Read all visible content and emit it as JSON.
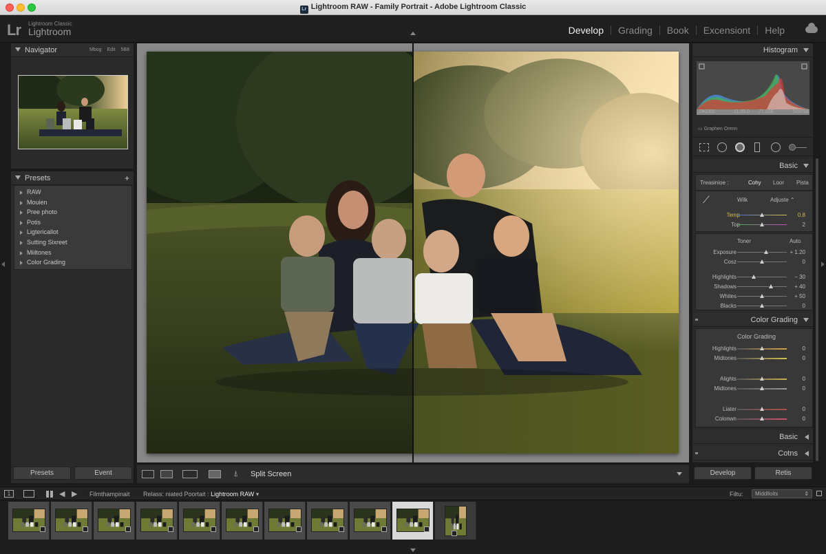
{
  "window": {
    "title": "Lightroom RAW - Family Portrait - Adobe Lightroom Classic",
    "app_icon": "Lr"
  },
  "logo": {
    "mark": "Lr",
    "small": "Lightroom Classic",
    "big": "Lightroom"
  },
  "modules": [
    {
      "label": "Develop",
      "active": true
    },
    {
      "label": "Grading",
      "active": false
    },
    {
      "label": "Book",
      "active": false
    },
    {
      "label": "Excensiont",
      "active": false
    },
    {
      "label": "Help",
      "active": false
    }
  ],
  "navigator": {
    "title": "Navigator",
    "options": [
      "Mbog",
      "Edit",
      "5B8"
    ]
  },
  "presets": {
    "title": "Presets",
    "items": [
      "RAW",
      "Mouien",
      "Pree photo",
      "Potis",
      "Ligtericallot",
      "Sutting Sixreet",
      "Miiltones",
      "Color Grading"
    ]
  },
  "left_buttons": {
    "presets": "Presets",
    "event": "Event"
  },
  "toolbar": {
    "view_mode": "Split Screen"
  },
  "histogram": {
    "title": "Histogram",
    "info": [
      "DKD00",
      "11.35.0",
      "77.10E",
      "Normal"
    ],
    "caption": "Graphen Orenn"
  },
  "basic": {
    "title": "Basic",
    "treatment_label": "Treasinioe :",
    "treatment_opts": [
      "Cohy",
      "Loor",
      "Pista"
    ],
    "wb_label": "Wilk",
    "wb_value": "Adjuste",
    "temp": {
      "label": "Temp",
      "value": "0.8",
      "pos": 0.5
    },
    "tint": {
      "label": "Top",
      "value": "2",
      "pos": 0.5
    },
    "tone_label": "Toner",
    "auto_label": "Auto",
    "sliders": [
      {
        "label": "Exposure",
        "value": "+ 1.20",
        "pos": 0.58
      },
      {
        "label": "Cosz",
        "value": "0",
        "pos": 0.5
      },
      {
        "label": "Highlights",
        "value": "− 30",
        "pos": 0.33
      },
      {
        "label": "Shadows",
        "value": "+ 40",
        "pos": 0.68
      },
      {
        "label": "Whites",
        "value": "+ 50",
        "pos": 0.5
      },
      {
        "label": "Blacks",
        "value": "0",
        "pos": 0.5
      }
    ]
  },
  "color_grading": {
    "title": "Color Grading",
    "subtitle": "Color Grading",
    "sliders": [
      {
        "label": "Highlights",
        "value": "0",
        "pos": 0.5
      },
      {
        "label": "Midtones",
        "value": "0",
        "pos": 0.5
      },
      {
        "label": "Alights",
        "value": "0",
        "pos": 0.5
      },
      {
        "label": "Midtones",
        "value": "0",
        "pos": 0.5
      },
      {
        "label": "Liater",
        "value": "0",
        "pos": 0.5
      },
      {
        "label": "Colonwn",
        "value": "0",
        "pos": 0.5
      }
    ]
  },
  "collapsed_panels": [
    "Basic",
    "Cotns"
  ],
  "right_buttons": {
    "develop": "Develop",
    "reset": "Retis"
  },
  "filmbar": {
    "source": "Filmthampinait",
    "path_prefix": "Relass: niated Poortait :",
    "path_current": "Lightroom RAW",
    "filter_label": "Filtu:",
    "filter_value": "Middlloits"
  },
  "filmstrip": {
    "count": 11,
    "selected_index": 9
  },
  "colors": {
    "accent_temp": "#d8b84a",
    "panel": "#2a2a2a",
    "canvas": "#888888"
  }
}
